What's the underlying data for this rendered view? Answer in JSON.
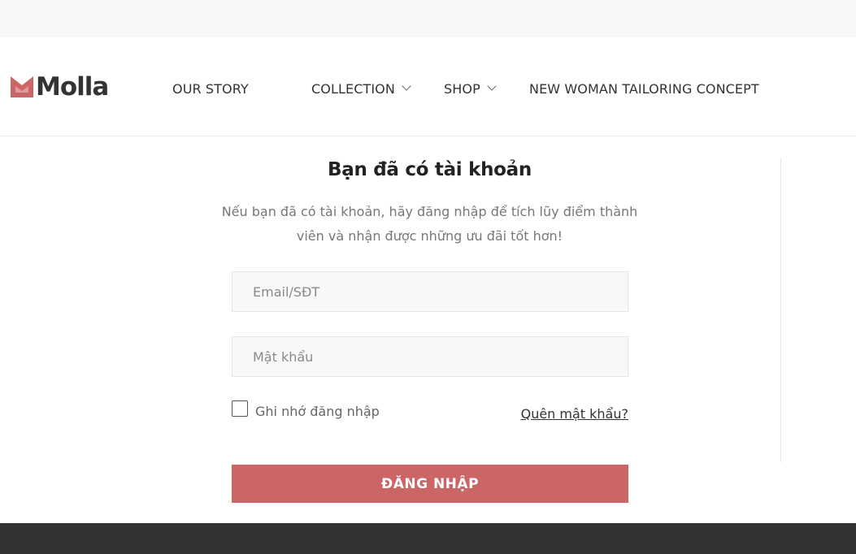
{
  "brand": {
    "name": "Molla",
    "accent_color": "#cc6666"
  },
  "nav": [
    {
      "label": "OUR STORY",
      "has_dropdown": false
    },
    {
      "label": "COLLECTION",
      "has_dropdown": true
    },
    {
      "label": "SHOP",
      "has_dropdown": true
    },
    {
      "label": "NEW WOMAN TAILORING CONCEPT",
      "has_dropdown": false
    }
  ],
  "login": {
    "title": "Bạn đã có tài khoản",
    "description_line1": "Nếu bạn đã có tài khoản, hãy đăng nhập để tích lũy điểm thành",
    "description_line2": "viên và nhận được những ưu đãi tốt hơn!",
    "email_placeholder": "Email/SĐT",
    "password_placeholder": "Mật khẩu",
    "remember_label": "Ghi nhớ đăng nhập",
    "remember_checked": false,
    "forgot_label": "Quên mật khẩu?",
    "submit_label": "ĐĂNG NHẬP"
  },
  "colors": {
    "topbar": "#f7f7f7",
    "button": "#cc6666",
    "footer": "#333333"
  },
  "icons": [
    "logo-mark-icon",
    "chevron-down-icon"
  ]
}
